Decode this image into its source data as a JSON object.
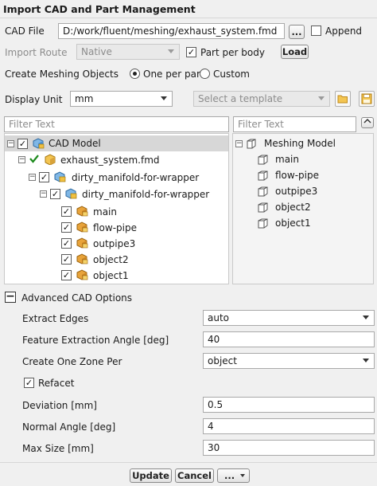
{
  "header": {
    "title": "Import CAD and Part Management"
  },
  "cad_file": {
    "label": "CAD File",
    "value": "D:/work/fluent/meshing/exhaust_system.fmd",
    "browse": "...",
    "append": "Append"
  },
  "import_route": {
    "label": "Import Route",
    "value": "Native",
    "part_per_body": "Part per body",
    "load": "Load"
  },
  "meshing_objects": {
    "label": "Create Meshing Objects",
    "option1": "One per part",
    "option2": "Custom"
  },
  "display_unit": {
    "label": "Display Unit",
    "value": "mm",
    "template_placeholder": "Select a template"
  },
  "filters": {
    "left_placeholder": "Filter Text",
    "right_placeholder": "Filter Text"
  },
  "cad_tree": {
    "root": "CAD Model",
    "file": "exhaust_system.fmd",
    "assembly1": "dirty_manifold-for-wrapper",
    "assembly2": "dirty_manifold-for-wrapper",
    "parts": [
      "main",
      "flow-pipe",
      "outpipe3",
      "object2",
      "object1"
    ]
  },
  "mesh_tree": {
    "root": "Meshing Model",
    "items": [
      "main",
      "flow-pipe",
      "outpipe3",
      "object2",
      "object1"
    ]
  },
  "advanced": {
    "title": "Advanced CAD Options",
    "extract_edges": {
      "label": "Extract Edges",
      "value": "auto"
    },
    "feature_angle": {
      "label": "Feature Extraction Angle [deg]",
      "value": "40"
    },
    "one_zone_per": {
      "label": "Create One Zone Per",
      "value": "object"
    },
    "refacet": "Refacet",
    "deviation": {
      "label": "Deviation [mm]",
      "value": "0.5"
    },
    "normal_angle": {
      "label": "Normal Angle [deg]",
      "value": "4"
    },
    "max_size": {
      "label": "Max Size [mm]",
      "value": "30"
    }
  },
  "footer": {
    "update": "Update",
    "cancel": "Cancel",
    "more": "..."
  },
  "colors": {
    "accent_green": "#1c8a1c",
    "part_orange": "#e8a33a",
    "selected_row": "#d7d7d7"
  }
}
